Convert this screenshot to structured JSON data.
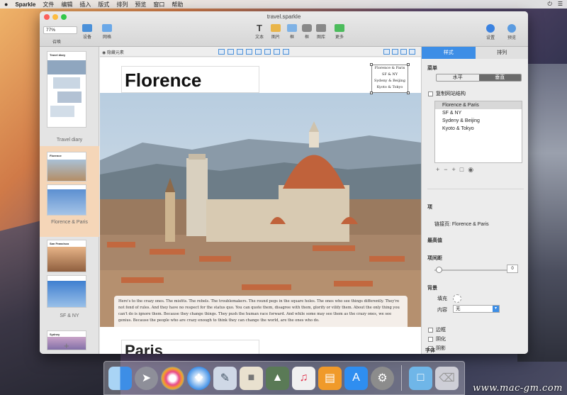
{
  "menubar": {
    "apple": "",
    "app_name": "Sparkle",
    "items": [
      "文件",
      "编辑",
      "插入",
      "版式",
      "排列",
      "预览",
      "窗口",
      "帮助"
    ]
  },
  "window": {
    "title": "travel.sparkle",
    "zoom_value": "77%",
    "zoom_label": "召唤",
    "toolbar": {
      "device": "设备",
      "layout": "网格",
      "text": "文本",
      "image": "图片",
      "shape": "框",
      "box": "框",
      "gallery": "图库",
      "more": "更多",
      "settings": "设置",
      "preview": "预览"
    }
  },
  "slides": {
    "groups": [
      {
        "label": "Travel diary",
        "thumb_title": "Travel diary"
      },
      {
        "label": "Florence & Paris",
        "thumb_title": "Florence"
      },
      {
        "label": "SF & NY",
        "thumb_title": "San Francisco"
      },
      {
        "label": "",
        "thumb_title": "Sydney"
      }
    ],
    "add": "+"
  },
  "canvas": {
    "hide_toggle": "隐藏元素",
    "title": "Florence",
    "next_title": "Paris",
    "links": [
      "Florence & Paris",
      "SF & NY",
      "Sydeny & Beijing",
      "Kyoto & Tokyo"
    ],
    "caption": "Here's to the crazy ones. The misfits. The rebels. The troublemakers. The round pegs in the square holes. The ones who see things differently. They're not fond of rules. And they have no respect for the status quo. You can quote them, disagree with them, glorify or vilify them. About the only thing you can't do is ignore them. Because they change things. They push the human race forward. And while some may see them as the crazy ones, we see genius. Because the people who are crazy enough to think they can change the world, are the ones who do."
  },
  "inspector": {
    "tabs": [
      "样式",
      "排列"
    ],
    "menu_section": "菜单",
    "orientation": [
      "水平",
      "垂直"
    ],
    "copy_link_label": "复制网站结构",
    "menu_items": [
      "Florence & Paris",
      "SF & NY",
      "Sydeny & Beijing",
      "Kyoto & Tokyo"
    ],
    "item_section": "项",
    "link_row": "链接页: Florence & Paris",
    "height_section": "最高值",
    "spacing_section": "项间距",
    "spacing_value": "0",
    "background_section": "背景",
    "fill_label": "填充",
    "content_label": "内容",
    "content_value": "无",
    "border_label": "边框",
    "shadow1_label": "阴化",
    "shadow2_label": "阴影",
    "font_section": "字体"
  },
  "dock": {
    "apps": [
      "finder-icon",
      "launchpad-icon",
      "game-center-icon",
      "safari-icon",
      "preview-icon",
      "photo-icon",
      "photos-icon",
      "music-icon",
      "ibooks-icon",
      "app-store-icon",
      "system-preferences-icon",
      "downloads-folder-icon",
      "trash-icon"
    ]
  },
  "watermark": "www.mac-gm.com",
  "colors": {
    "accent": "#3d8ee6",
    "selected_slide": "#f5d6b8"
  }
}
